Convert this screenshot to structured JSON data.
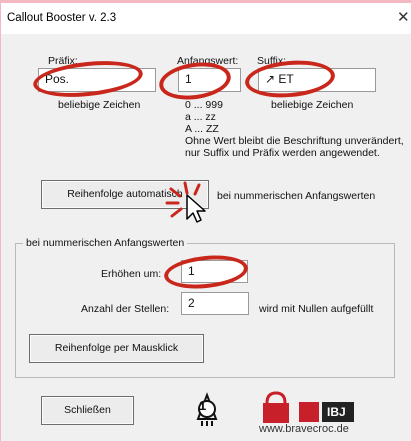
{
  "window": {
    "title": "Callout Booster v. 2.3",
    "close": "✕"
  },
  "prefix": {
    "label": "Präfix:",
    "value": "Pos.",
    "hint": "beliebige Zeichen"
  },
  "start": {
    "label": "Anfangswert:",
    "value": "1",
    "hints": [
      "0 ... 999",
      "a ... zz",
      "A ... ZZ"
    ]
  },
  "suffix": {
    "label": "Suffix:",
    "value": "↗ ET",
    "hint": "beliebige Zeichen"
  },
  "note": {
    "line1": "Ohne Wert bleibt die Beschriftung unverändert,",
    "line2": "nur Suffix und Präfix werden angewendet."
  },
  "auto_button": {
    "label": "Reihenfolge automatisch",
    "note": "bei nummerischen Anfangswerten"
  },
  "group": {
    "title": "bei nummerischen Anfangswerten",
    "increment_label": "Erhöhen um:",
    "increment_value": "1",
    "digits_label": "Anzahl der Stellen:",
    "digits_value": "2",
    "digits_note": "wird mit Nullen aufgefüllt",
    "click_button": "Reihenfolge per Mausklick"
  },
  "close_button": "Schließen",
  "brand": {
    "logo_text": "IBJ",
    "url": "www.bravecroc.de",
    "rocket_number": "1"
  },
  "colors": {
    "background": "#f3b8c1",
    "annotation": "#c9271c",
    "brand_red": "#c8202a",
    "dialog": "#f0f0f0"
  },
  "icons": [
    "close-icon",
    "cursor-icon",
    "rocket-icon",
    "lock-icon",
    "ibj-logo"
  ]
}
